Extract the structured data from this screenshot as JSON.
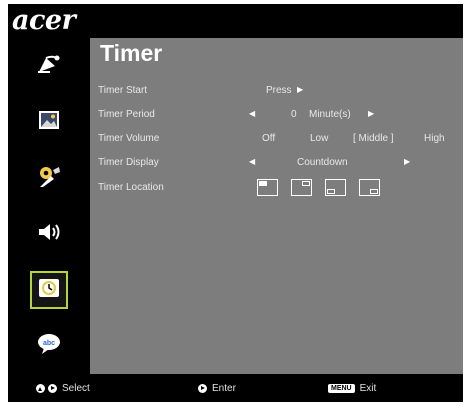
{
  "brand": {
    "logo_text": "acer"
  },
  "sidebar": {
    "items": [
      {
        "icon": "satellite-dish-icon",
        "selected": false
      },
      {
        "icon": "picture-icon",
        "selected": false
      },
      {
        "icon": "settings-tools-icon",
        "selected": false
      },
      {
        "icon": "speaker-icon",
        "selected": false
      },
      {
        "icon": "timer-icon",
        "selected": true
      },
      {
        "icon": "language-icon",
        "selected": false
      }
    ]
  },
  "menu": {
    "title": "Timer",
    "rows": {
      "timer_start": {
        "label": "Timer Start",
        "value": "Press"
      },
      "timer_period": {
        "label": "Timer Period",
        "value": "0",
        "unit": "Minute(s)"
      },
      "timer_volume": {
        "label": "Timer Volume",
        "options": [
          "Off",
          "Low",
          "[ Middle ]",
          "High"
        ],
        "selected": "Middle"
      },
      "timer_display": {
        "label": "Timer Display",
        "value": "Countdown"
      },
      "timer_location": {
        "label": "Timer Location",
        "options": [
          "top-left",
          "top-right",
          "bottom-left",
          "bottom-right"
        ],
        "selected": "top-left"
      }
    }
  },
  "footer": {
    "select_label": "Select",
    "enter_label": "Enter",
    "menu_key_label": "MENU",
    "exit_label": "Exit"
  },
  "colors": {
    "panel": "#7d7d7d",
    "highlight": "#b6d53a",
    "background": "#000000"
  }
}
